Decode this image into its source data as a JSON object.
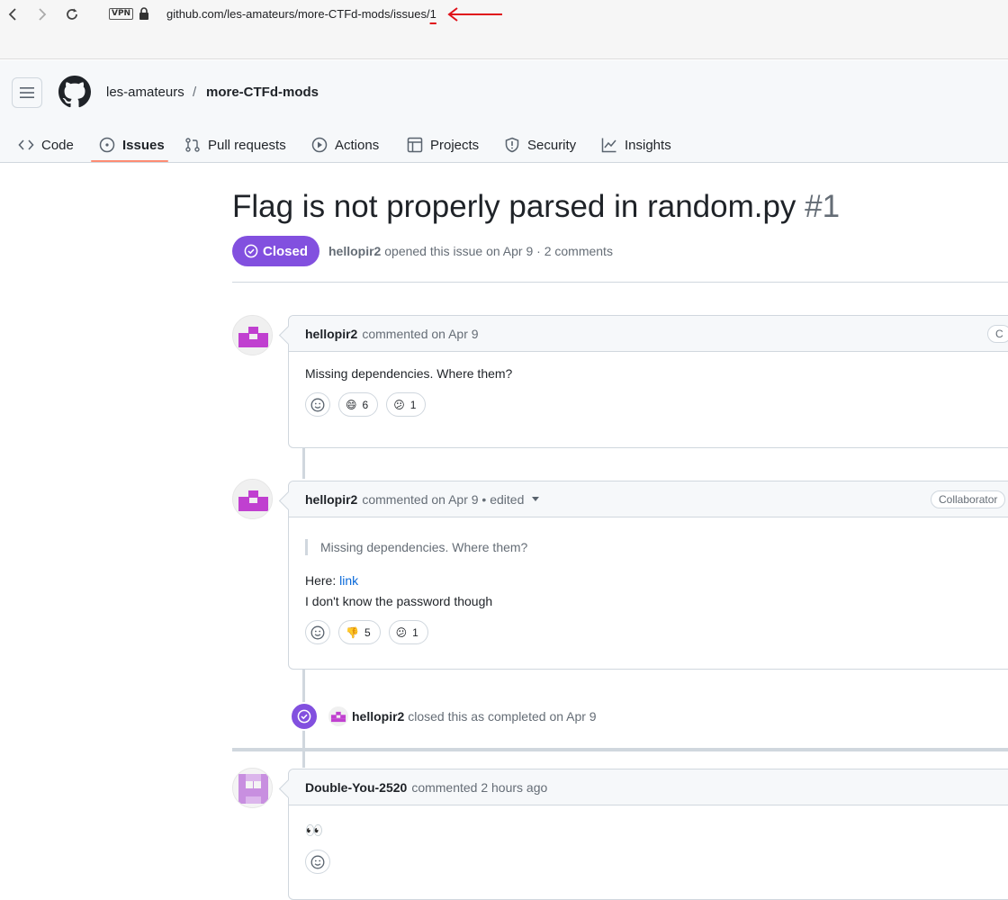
{
  "browser": {
    "vpn_label": "VPN",
    "url_prefix": "github.com/les-amateurs/more-CTFd-mods/issues/",
    "url_issue": "1"
  },
  "repo": {
    "owner": "les-amateurs",
    "separator": "/",
    "name": "more-CTFd-mods"
  },
  "tabs": [
    {
      "label": "Code",
      "icon": "code-icon"
    },
    {
      "label": "Issues",
      "icon": "issue-opened-icon"
    },
    {
      "label": "Pull requests",
      "icon": "git-pull-request-icon"
    },
    {
      "label": "Actions",
      "icon": "play-icon"
    },
    {
      "label": "Projects",
      "icon": "table-icon"
    },
    {
      "label": "Security",
      "icon": "shield-icon"
    },
    {
      "label": "Insights",
      "icon": "graph-icon"
    }
  ],
  "issue": {
    "title": "Flag is not properly parsed in random.py",
    "number": "#1",
    "state": "Closed",
    "author": "hellopir2",
    "meta_rest": "opened this issue on Apr 9 · 2 comments"
  },
  "comments": [
    {
      "author": "hellopir2",
      "meta": "commented on Apr 9",
      "badge": "C",
      "body": "Missing dependencies. Where them?",
      "reactions": [
        {
          "emoji": "😄",
          "count": "6"
        },
        {
          "emoji": "😕",
          "count": "1"
        }
      ]
    },
    {
      "author": "hellopir2",
      "meta": "commented on Apr 9 • edited",
      "badge": "Collaborator",
      "quote": "Missing dependencies. Where them?",
      "here_prefix": "Here: ",
      "link_text": "link",
      "line2": "I don't know the password though",
      "reactions": [
        {
          "emoji": "👎",
          "count": "5"
        },
        {
          "emoji": "😕",
          "count": "1"
        }
      ]
    },
    {
      "author": "Double-You-2520",
      "meta": "commented 2 hours ago",
      "body": "👀"
    }
  ],
  "event": {
    "actor": "hellopir2",
    "text": "closed this as completed on Apr 9"
  },
  "colors": {
    "closed_purple": "#8250df",
    "tab_underline": "#fd8c73",
    "link_blue": "#0969da",
    "annotation_red": "#e0121a"
  }
}
